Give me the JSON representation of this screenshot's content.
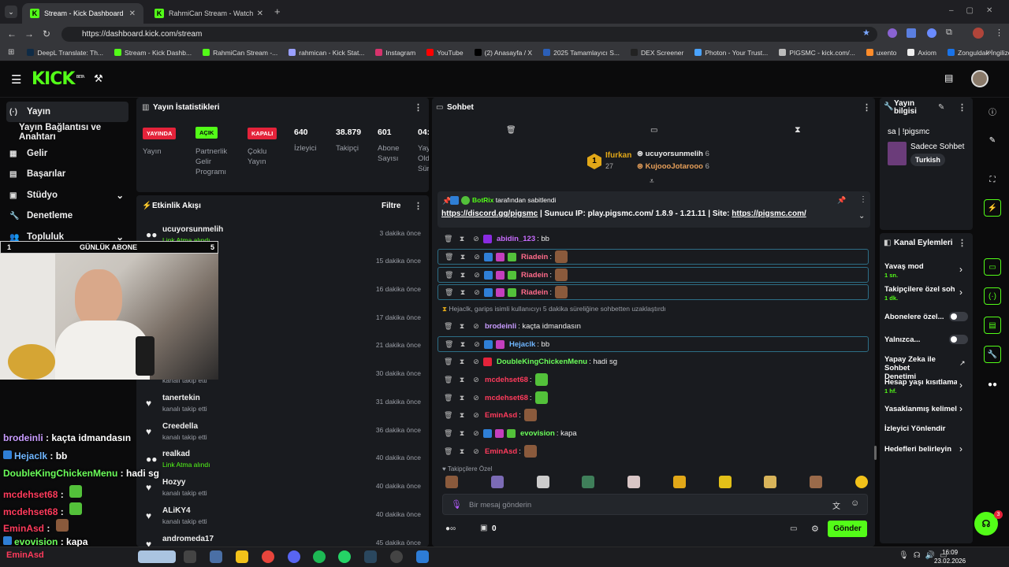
{
  "browser": {
    "tabs": [
      {
        "label": "Stream - Kick Dashboard",
        "active": true
      },
      {
        "label": "RahmiCan Stream - Watch Live",
        "active": false
      }
    ],
    "url": "https://dashboard.kick.com/stream",
    "bookmarks": [
      "DeepL Translate: Th...",
      "Stream - Kick Dashb...",
      "RahmiCan Stream -...",
      "rahmican - Kick Stat...",
      "Instagram",
      "YouTube",
      "(2) Anasayfa / X",
      "2025 Tamamlayıcı S...",
      "DEX Screener",
      "Photon - Your Trust...",
      "PIGSMC - kick.com/...",
      "uxento",
      "Axiom",
      "Zonguldak İngilizce..."
    ]
  },
  "kick": {
    "logo": "KICK",
    "beta": "BETA"
  },
  "leftnav": [
    {
      "label": "Yayın",
      "icon": "(·)"
    },
    {
      "label": "Yayın Bağlantısı ve Anahtarı",
      "icon": ""
    },
    {
      "label": "Gelir",
      "icon": "▦"
    },
    {
      "label": "Başarılar",
      "icon": "▤"
    },
    {
      "label": "Stüdyo",
      "icon": "▣"
    },
    {
      "label": "Denetleme",
      "icon": "🔧"
    },
    {
      "label": "Topluluk",
      "icon": "👥"
    }
  ],
  "stats": {
    "title": "Yayın İstatistikleri",
    "badges": [
      {
        "text": "YAYINDA",
        "label": "Yayın"
      },
      {
        "text": "AÇIK",
        "label": "Partnerlik Gelir Programı"
      },
      {
        "text": "KAPALI",
        "label": "Çoklu Yayın"
      }
    ],
    "numbers": [
      {
        "value": "640",
        "label": "İzleyici"
      },
      {
        "value": "38.879",
        "label": "Takipçi"
      },
      {
        "value": "601",
        "label": "Abone Sayısı"
      },
      {
        "value": "04:",
        "label": "Yay Old Sür"
      }
    ]
  },
  "activity": {
    "title": "Etkinlik Akışı",
    "filter": "Filtre",
    "items": [
      {
        "name": "ucuyorsunmelih",
        "sub": "Link Atma alındı",
        "time": "3 dakika önce",
        "icon": "●●",
        "green": true
      },
      {
        "name": "",
        "sub": "",
        "time": "15 dakika önce"
      },
      {
        "name": "",
        "sub": "",
        "time": "16 dakika önce"
      },
      {
        "name": "",
        "sub": "",
        "time": "17 dakika önce"
      },
      {
        "name": "",
        "sub": "",
        "time": "21 dakika önce"
      },
      {
        "name": "",
        "sub": "kanalı takip etti",
        "time": "30 dakika önce"
      },
      {
        "name": "tanertekin",
        "sub": "kanalı takip etti",
        "time": "31 dakika önce",
        "icon": "♥"
      },
      {
        "name": "Creedella",
        "sub": "kanalı takip etti",
        "time": "36 dakika önce",
        "icon": "♥"
      },
      {
        "name": "realkad",
        "sub": "Link Atma alındı",
        "time": "40 dakika önce",
        "icon": "●●",
        "green": true
      },
      {
        "name": "Hozyy",
        "sub": "kanalı takip etti",
        "time": "40 dakika önce",
        "icon": "♥"
      },
      {
        "name": "ALiKY4",
        "sub": "kanalı takip etti",
        "time": "40 dakika önce",
        "icon": "♥"
      },
      {
        "name": "andromeda17",
        "sub": "",
        "time": "45 dakika önce",
        "icon": "♥"
      }
    ]
  },
  "webcam": {
    "label": "GÜNLÜK ABONE",
    "left": "1",
    "right": "5"
  },
  "overlay_chat": [
    {
      "user": "brodeinli",
      "msg": " : kaçta idmandasın",
      "color": "#c99cff"
    },
    {
      "user": "Hejaclk",
      "msg": " : bb",
      "color": "#6fb6ff"
    },
    {
      "user": "DoubleKingChickenMenu",
      "msg": " : hadi sg",
      "color": "#6bff5a"
    },
    {
      "user": "mcdehset68",
      "msg": " : ",
      "color": "#ff3b5c"
    },
    {
      "user": "mcdehset68",
      "msg": " : ",
      "color": "#ff3b5c"
    },
    {
      "user": "EminAsd",
      "msg": " : ",
      "color": "#ff3b5c"
    },
    {
      "user": "evovision",
      "msg": " : kapa",
      "color": "#6bff5a"
    }
  ],
  "chat": {
    "title": "Sohbet",
    "leaders": [
      {
        "rank": "1",
        "name": "Ifurkan",
        "count": "27"
      },
      {
        "name": "ucuyorsunmelih",
        "count": "6"
      },
      {
        "name": "KujoooJotarooo",
        "count": "6"
      }
    ],
    "pinned_by": "BotRix tarafından sabitlendi",
    "pinned_link": "https://discord.gg/pigsmc",
    "pinned_mid": " | Sunucu IP: play.pigsmc.com/ 1.8.9 - 1.21.11 | Site: ",
    "pinned_site": "https://pigsmc.com/",
    "timeout_notice": "Hejaclk, garips isimli kullanıcıyı 5 dakika süreliğine sohbetten uzaklaştırdı",
    "messages": [
      {
        "user": "abidin_123",
        "msg": ": bb",
        "color": "#c96cff",
        "box": false
      },
      {
        "user": "Riadein",
        "msg": ":",
        "color": "#ff6b8a",
        "box": true,
        "emote": true
      },
      {
        "user": "Riadein",
        "msg": ":",
        "color": "#ff6b8a",
        "box": true,
        "emote": true
      },
      {
        "user": "Riadein",
        "msg": ":",
        "color": "#ff6b8a",
        "box": true,
        "emote": true
      },
      {
        "user": "brodeinli",
        "msg": ": kaçta idmandasın",
        "color": "#c99cff",
        "box": false
      },
      {
        "user": "Hejaclk",
        "msg": ": bb",
        "color": "#6fb6ff",
        "box": true
      },
      {
        "user": "DoubleKingChickenMenu",
        "msg": ": hadi sg",
        "color": "#6bff5a",
        "box": false
      },
      {
        "user": "mcdehset68",
        "msg": ":",
        "color": "#ff3b5c",
        "box": false,
        "emote": true
      },
      {
        "user": "mcdehset68",
        "msg": ":",
        "color": "#ff3b5c",
        "box": false,
        "emote": true
      },
      {
        "user": "EminAsd",
        "msg": ":",
        "color": "#ff3b5c",
        "box": false,
        "emote": true
      },
      {
        "user": "evovision",
        "msg": ": kapa",
        "color": "#6bff5a",
        "box": false
      },
      {
        "user": "EminAsd",
        "msg": ":",
        "color": "#ff3b5c",
        "box": false,
        "emote": true
      }
    ],
    "followers_only": "Takipçilere Özel",
    "placeholder": "Bir mesaj gönderin",
    "send": "Gönder",
    "count": "0"
  },
  "streaminfo": {
    "title": "Yayın bilgisi",
    "stream_title": "sa | !pigsmc",
    "category": "Sadece Sohbet",
    "language": "Turkish"
  },
  "channel_actions": {
    "title": "Kanal Eylemleri",
    "items": [
      {
        "label": "Yavaş mod",
        "sub": "1 sn.",
        "kind": "arrow"
      },
      {
        "label": "Takipçilere özel soh",
        "sub": "1 dk.",
        "kind": "arrow"
      },
      {
        "label": "Abonelere özel...",
        "sub": "",
        "kind": "toggle"
      },
      {
        "label": "Yalnızca...",
        "sub": "",
        "kind": "toggle"
      },
      {
        "label": "Yapay Zeka ile Sohbet Denetimi",
        "sub": "",
        "kind": "ext"
      },
      {
        "label": "Hesap yaşı kısıtlama",
        "sub": "1 hf.",
        "kind": "arrow"
      },
      {
        "label": "Yasaklanmış kelimel",
        "sub": "",
        "kind": "arrow"
      },
      {
        "label": "İzleyici Yönlendir",
        "sub": "",
        "kind": "none"
      },
      {
        "label": "Hedefleri belirleyin",
        "sub": "",
        "kind": "arrow"
      }
    ]
  },
  "taskbar": {
    "time": "16:09",
    "date": "23.02.2026",
    "notif": "3"
  }
}
